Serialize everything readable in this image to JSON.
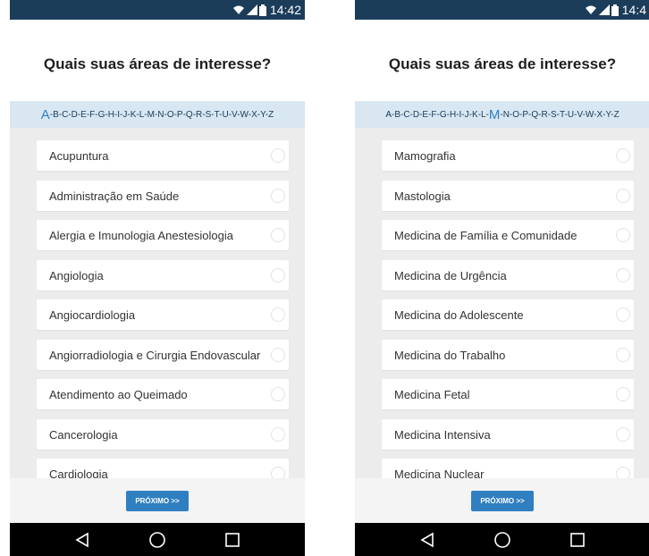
{
  "status_bar": {
    "time_left": "14:42",
    "time_right": "14:4"
  },
  "screen_left": {
    "title": "Quais suas áreas de interesse?",
    "alphabet": {
      "before": "",
      "active": "A",
      "after": "-B-C-D-E-F-G-H-I-J-K-L-M-N-O-P-Q-R-S-T-U-V-W-X-Y-Z"
    },
    "items": [
      "Acupuntura",
      "Administração em Saúde",
      "Alergia e Imunologia Anestesiologia",
      "Angiologia",
      "Angiocardiologia",
      "Angiorradiologia e Cirurgia Endovascular",
      "Atendimento ao Queimado",
      "Cancerologia",
      "Cardiologia"
    ],
    "next_label": "PRÓXIMO >>"
  },
  "screen_right": {
    "title": "Quais suas áreas de interesse?",
    "alphabet": {
      "before": "A-B-C-D-E-F-G-H-I-J-K-L-",
      "active": "M",
      "after": "-N-O-P-Q-R-S-T-U-V-W-X-Y-Z"
    },
    "items": [
      "Mamografia",
      "Mastologia",
      "Medicina de Família e Comunidade",
      "Medicina de Urgência",
      "Medicina do Adolescente",
      "Medicina do Trabalho",
      "Medicina Fetal",
      "Medicina Intensiva",
      "Medicina Nuclear"
    ],
    "next_label": "PRÓXIMO >>"
  },
  "colors": {
    "status_bar": "#1b3d5a",
    "alpha_bar": "#d8e7f1",
    "accent": "#2f7fc1",
    "list_bg": "#ececec",
    "nav_bar": "#000000"
  },
  "icons": {
    "status": [
      "wifi-icon",
      "signal-icon",
      "battery-icon"
    ],
    "nav": [
      "back-icon",
      "home-icon",
      "recents-icon"
    ]
  }
}
